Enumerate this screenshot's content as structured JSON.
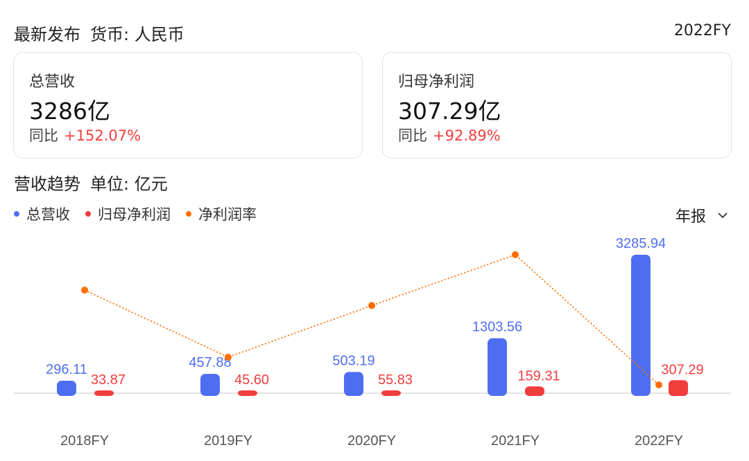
{
  "header": {
    "title": "最新发布",
    "currency": "货币: 人民币",
    "period": "2022FY"
  },
  "cards": [
    {
      "label": "总营收",
      "value": "3286亿",
      "yoy_label": "同比",
      "yoy_value": "+152.07%"
    },
    {
      "label": "归母净利润",
      "value": "307.29亿",
      "yoy_label": "同比",
      "yoy_value": "+92.89%"
    }
  ],
  "trend": {
    "title": "营收趋势",
    "unit": "单位: 亿元",
    "period_select": "年报"
  },
  "colors": {
    "revenue": "#4e6ef2",
    "profit": "#f23d3d",
    "margin": "#ff6d00",
    "positive": "#f23d3d"
  },
  "chart_data": {
    "type": "bar",
    "categories": [
      "2018FY",
      "2019FY",
      "2020FY",
      "2021FY",
      "2022FY"
    ],
    "series": [
      {
        "name": "总营收",
        "type": "bar",
        "values": [
          296.11,
          457.88,
          503.19,
          1303.56,
          3285.94
        ],
        "labels": [
          "296.11",
          "457.88",
          "503.19",
          "1303.56",
          "3285.94"
        ]
      },
      {
        "name": "归母净利润",
        "type": "bar",
        "values": [
          33.87,
          45.6,
          55.83,
          159.31,
          307.29
        ],
        "labels": [
          "33.87",
          "45.60",
          "55.83",
          "159.31",
          "307.29"
        ]
      },
      {
        "name": "净利润率",
        "type": "line",
        "values": [
          11.44,
          9.96,
          11.1,
          12.22,
          9.35
        ]
      }
    ],
    "legend": "top-left"
  }
}
